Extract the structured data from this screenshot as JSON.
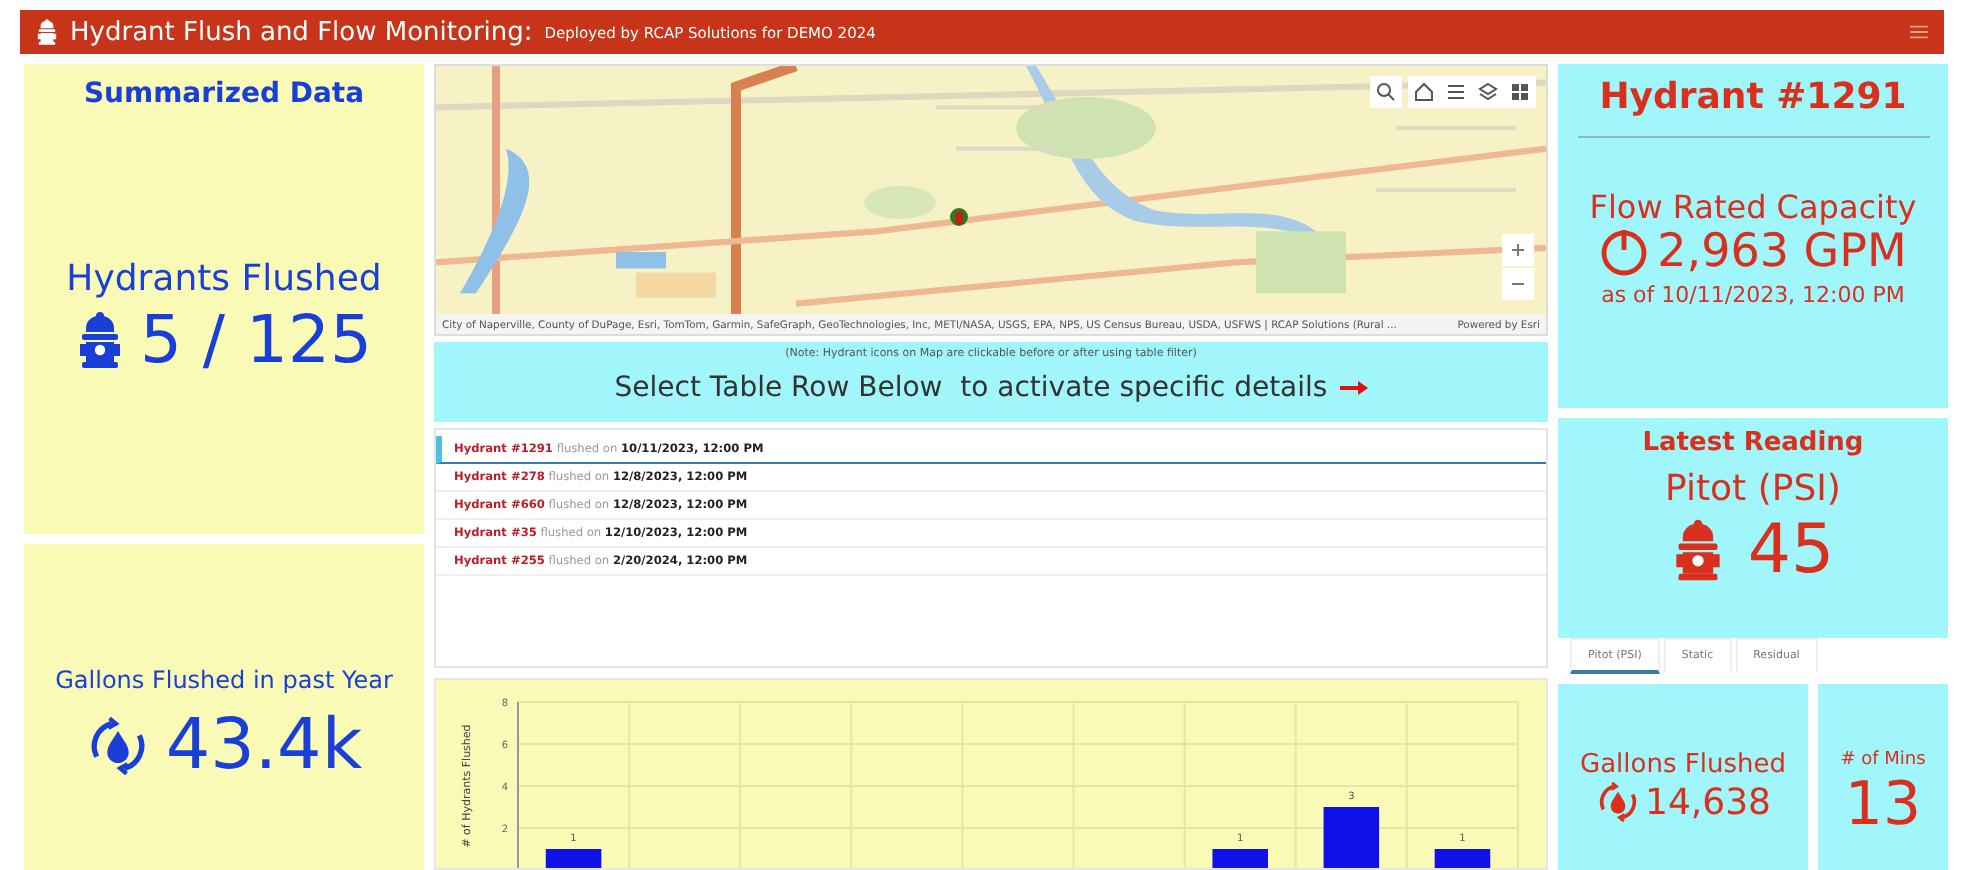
{
  "header": {
    "title": "Hydrant Flush and Flow Monitoring:",
    "subtitle": "Deployed by RCAP Solutions for DEMO 2024"
  },
  "summary": {
    "title": "Summarized Data",
    "flushed_label": "Hydrants Flushed",
    "flushed_value": "5 / 125",
    "gallons_label": "Gallons Flushed in past Year",
    "gallons_value": "43.4k"
  },
  "map": {
    "kind": "picture",
    "attribution": "City of Naperville, County of DuPage, Esri, TomTom, Garmin, SafeGraph, GeoTechnologies, Inc, METI/NASA, USGS, EPA, NPS, US Census Bureau, USDA, USFWS | RCAP Solutions (Rural ...",
    "powered": "Powered by Esri"
  },
  "banner": {
    "note": "(Note: Hydrant icons on Map are clickable before or after using table filter)",
    "instruction": "Select Table Row Below  to activate specific details"
  },
  "rows": [
    {
      "hydrant": "Hydrant #1291",
      "verb": "flushed on",
      "date": "10/11/2023, 12:00 PM",
      "selected": true
    },
    {
      "hydrant": "Hydrant #278",
      "verb": "flushed on",
      "date": "12/8/2023, 12:00 PM",
      "selected": false
    },
    {
      "hydrant": "Hydrant #660",
      "verb": "flushed on",
      "date": "12/8/2023, 12:00 PM",
      "selected": false
    },
    {
      "hydrant": "Hydrant #35",
      "verb": "flushed on",
      "date": "12/10/2023, 12:00 PM",
      "selected": false
    },
    {
      "hydrant": "Hydrant #255",
      "verb": "flushed on",
      "date": "2/20/2024, 12:00 PM",
      "selected": false
    }
  ],
  "chart_data": {
    "type": "bar",
    "ylabel": "# of Hydrants Flushed",
    "ylim": [
      0,
      8
    ],
    "yticks": [
      2,
      4,
      6,
      8
    ],
    "data_labels": true,
    "grid": true,
    "values": [
      1,
      null,
      null,
      null,
      null,
      null,
      1,
      3,
      1
    ]
  },
  "details": {
    "hydrant": "Hydrant #1291",
    "capacity_label": "Flow Rated Capacity",
    "capacity_value": "2,963 GPM",
    "as_of": "as of 10/11/2023, 12:00 PM",
    "reading_title": "Latest Reading",
    "reading_label": "Pitot (PSI)",
    "reading_value": "45"
  },
  "reading_tabs": [
    {
      "label": "Pitot (PSI)",
      "selected": true
    },
    {
      "label": "Static",
      "selected": false
    },
    {
      "label": "Residual",
      "selected": false
    }
  ],
  "gallons": {
    "label": "Gallons Flushed",
    "value": "14,638"
  },
  "minutes": {
    "label": "# of Mins",
    "value": "13"
  }
}
